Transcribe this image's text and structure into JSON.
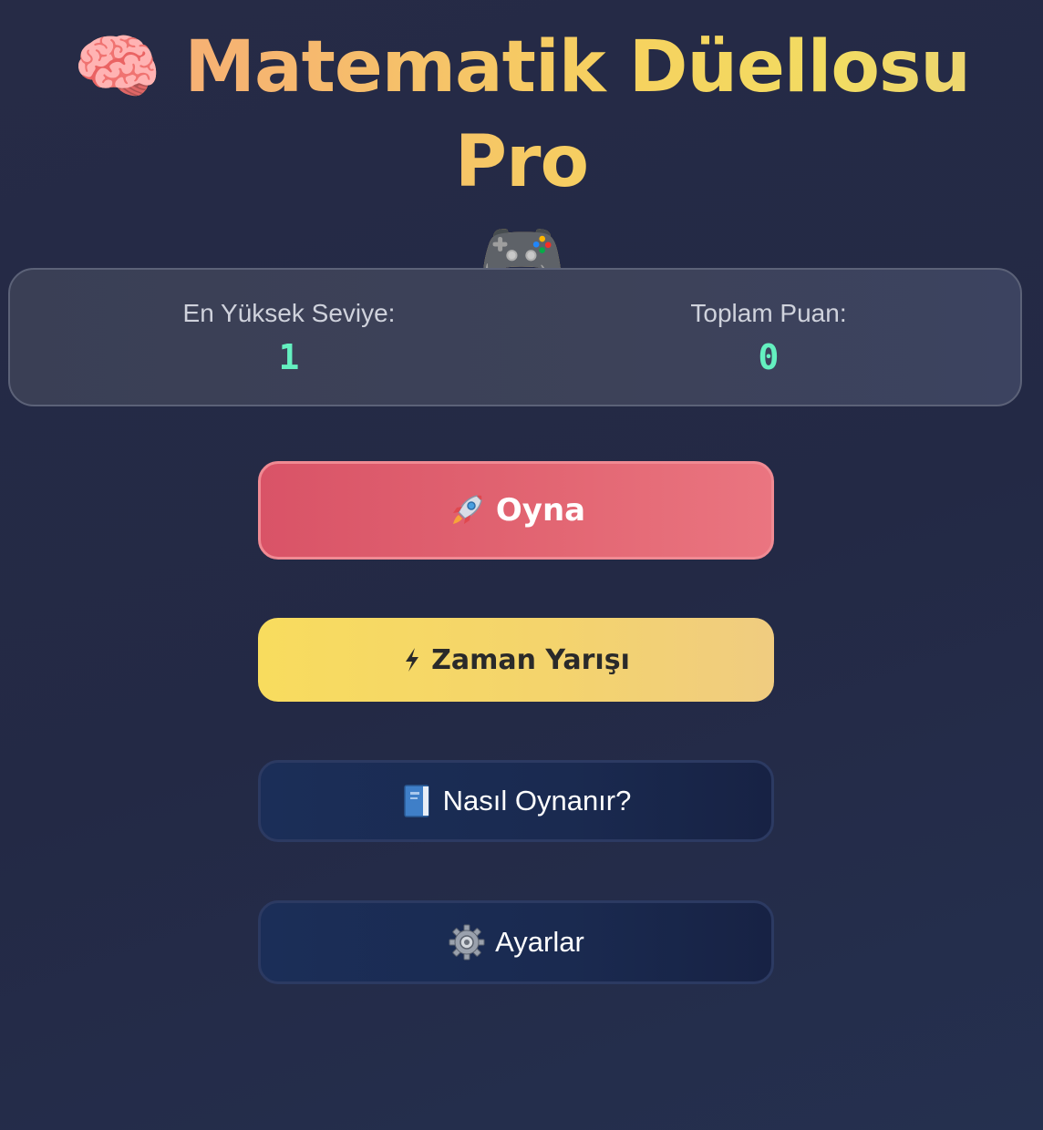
{
  "header": {
    "brain_icon": "🧠",
    "title": "Matematik Düellosu Pro",
    "gamepad_icon": "🎮"
  },
  "stats": {
    "highest_level_label": "En Yüksek Seviye:",
    "highest_level_value": "1",
    "total_score_label": "Toplam Puan:",
    "total_score_value": "0"
  },
  "menu": {
    "play_label": "Oyna",
    "play_icon": "rocket-icon",
    "time_race_label": "Zaman Yarışı",
    "time_race_icon": "lightning-icon",
    "how_to_play_label": "Nasıl Oynanır?",
    "how_to_play_icon": "book-icon",
    "settings_label": "Ayarlar",
    "settings_icon": "gear-icon"
  },
  "colors": {
    "background": "#252b47",
    "title_gradient_start": "#f6a57d",
    "title_gradient_end": "#f2dc62",
    "stat_value": "#64f0c0",
    "play_button": "#e26572",
    "time_race_button": "#f6d666",
    "secondary_button": "#1b2b52"
  }
}
